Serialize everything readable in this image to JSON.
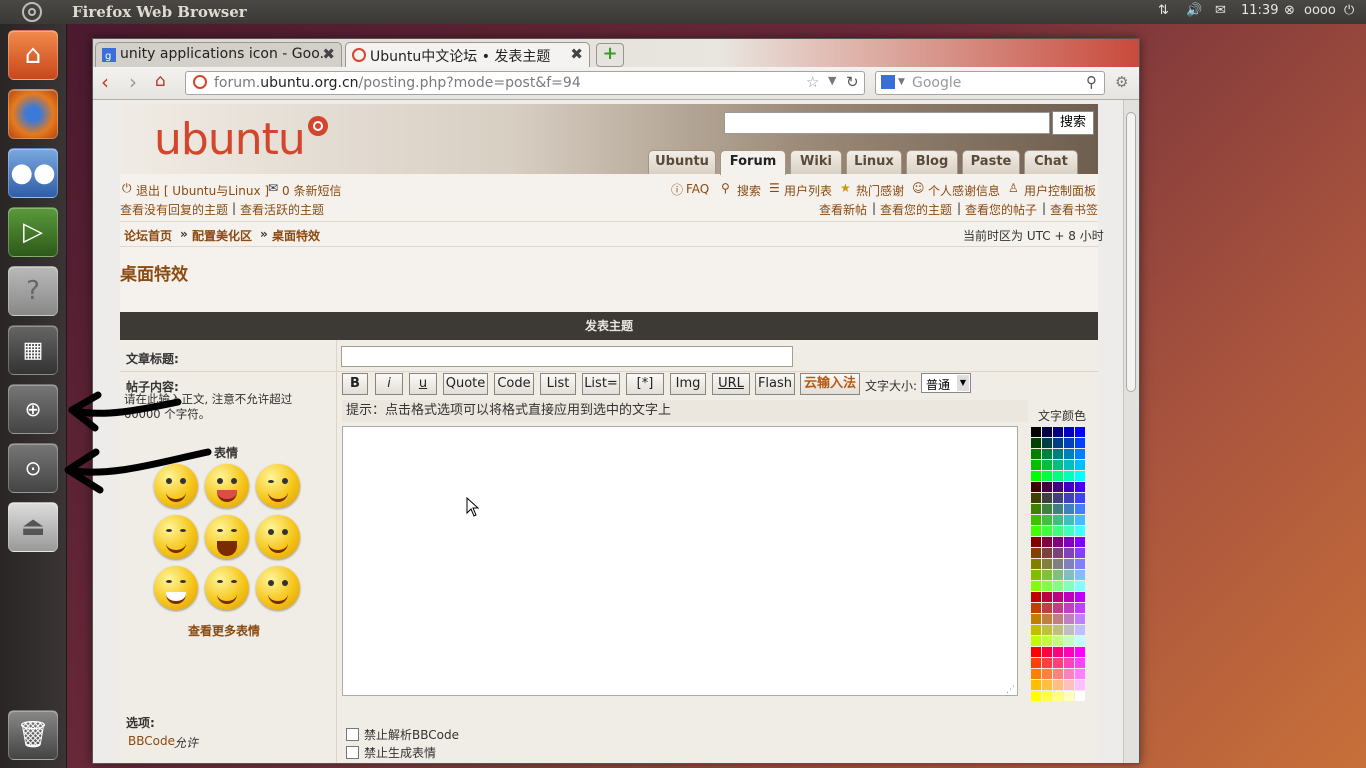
{
  "top_panel": {
    "title": "Firefox Web Browser",
    "time": "11:39",
    "user": "oooo"
  },
  "launcher": {
    "items": [
      "home-folder-icon",
      "firefox-icon",
      "empathy-icon",
      "terminal-icon",
      "help-icon",
      "workspace-switcher-icon",
      "zoom-in-icon",
      "zoom-page-icon",
      "usb-drive-icon",
      "trash-icon"
    ]
  },
  "browser": {
    "tabs": [
      {
        "label": "unity applications icon - Goo...",
        "active": false
      },
      {
        "label": "Ubuntu中文论坛 • 发表主题",
        "active": true
      }
    ],
    "url_domain": "forum.",
    "url_host": "ubuntu.org.cn",
    "url_path": "/posting.php?mode=post&f=94",
    "search_placeholder": "Google"
  },
  "site": {
    "logo_text": "ubuntu",
    "search_button": "搜索",
    "nav_tabs": [
      {
        "label": "Ubuntu",
        "active": false
      },
      {
        "label": "Forum",
        "active": true
      },
      {
        "label": "Wiki",
        "active": false
      },
      {
        "label": "Linux",
        "active": false
      },
      {
        "label": "Blog",
        "active": false
      },
      {
        "label": "Paste",
        "active": false
      },
      {
        "label": "Chat",
        "active": false
      }
    ],
    "logout": "退出 [ Ubuntu与Linux ]",
    "messages": "0 条新短信",
    "unanswered": "查看没有回复的主题",
    "active_topics": "查看活跃的主题",
    "faq": "FAQ",
    "search": "搜索",
    "memberlist": "用户列表",
    "hot_thanks": "热门感谢",
    "thanks_info": "个人感谢信息",
    "ucp": "用户控制面板",
    "new_posts": "查看新帖",
    "your_topics": "查看您的主题",
    "your_posts": "查看您的帖子",
    "bookmarks": "查看书签",
    "sep": "|",
    "crumbs": [
      "论坛首页",
      "配置美化区",
      "桌面特效"
    ],
    "crumb_sep": "»",
    "timezone": "当前时区为 UTC + 8 小时",
    "page_title": "桌面特效"
  },
  "form": {
    "header": "发表主题",
    "subject_label": "文章标题:",
    "subject_value": "",
    "body_label": "帖子内容:",
    "body_hint": "请在此输入正文, 注意不允许超过 60000 个字符。",
    "smilies_label": "表情",
    "more_smilies": "查看更多表情",
    "bbcode_buttons": [
      "B",
      "i",
      "u",
      "Quote",
      "Code",
      "List",
      "List=",
      "[*]",
      "Img",
      "URL",
      "Flash",
      "云输入法"
    ],
    "font_size_label": "文字大小:",
    "font_size_value": "普通",
    "tip": "提示：点击格式选项可以将格式直接应用到选中的文字上",
    "text_color_label": "文字颜色",
    "options_label": "选项:",
    "bbcode_link": "BBCode",
    "bbcode_state": "允许",
    "opt_disable_bbcode": "禁止解析BBCode",
    "opt_disable_smilies": "禁止生成表情"
  }
}
